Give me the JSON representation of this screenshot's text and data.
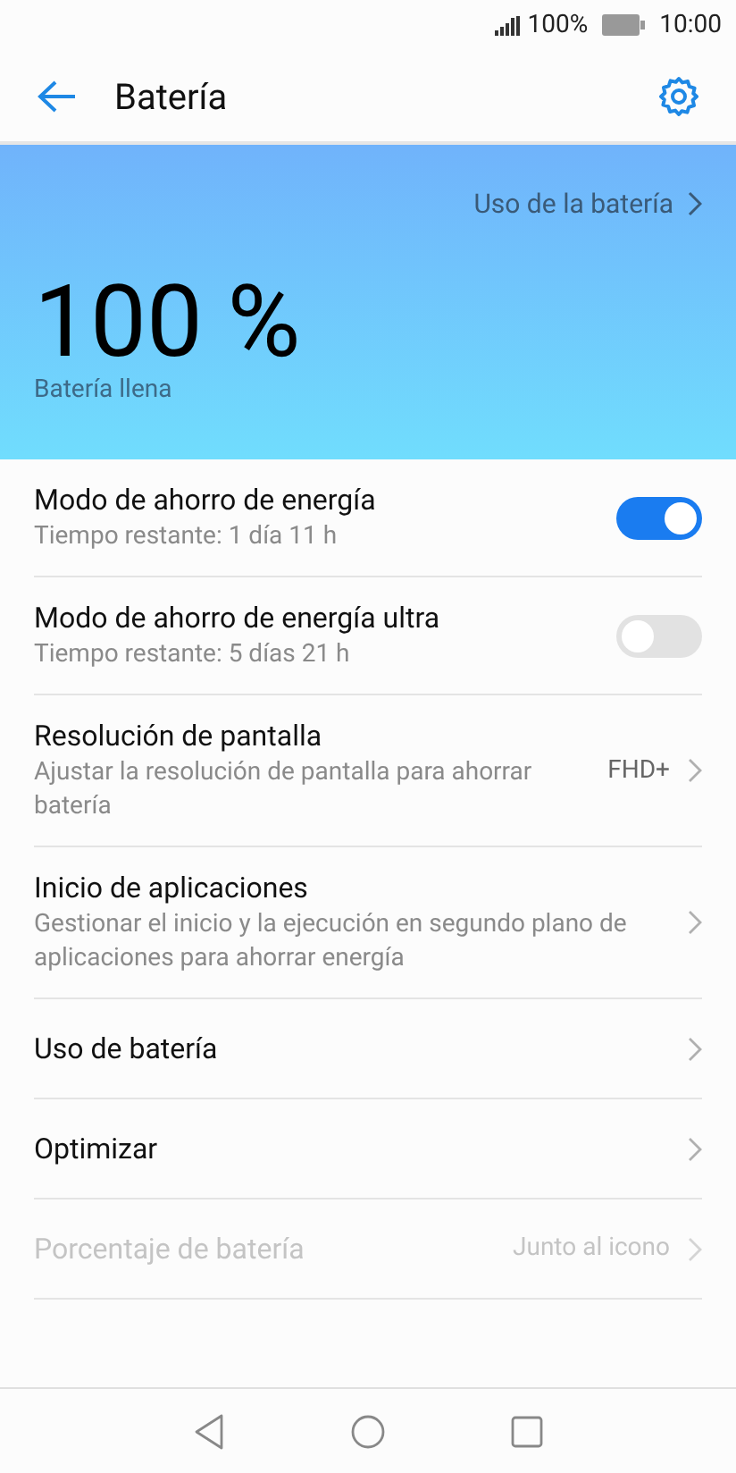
{
  "status_bar": {
    "battery": "100%",
    "time": "10:00"
  },
  "header": {
    "title": "Batería"
  },
  "hero": {
    "link": "Uso de la batería",
    "percent": "100 %",
    "status": "Batería llena"
  },
  "items": [
    {
      "kind": "toggle",
      "title": "Modo de ahorro de energía",
      "subtitle": "Tiempo restante: 1 día 11 h",
      "on": true,
      "disabled": false
    },
    {
      "kind": "toggle",
      "title": "Modo de ahorro de energía ultra",
      "subtitle": "Tiempo restante: 5 días 21 h",
      "on": false,
      "disabled": false
    },
    {
      "kind": "link",
      "title": "Resolución de pantalla",
      "subtitle": "Ajustar la resolución de pantalla para ahorrar batería",
      "value": "FHD+",
      "disabled": false
    },
    {
      "kind": "link",
      "title": "Inicio de aplicaciones",
      "subtitle": "Gestionar el inicio y la ejecución en segundo plano de aplicaciones para ahorrar energía",
      "disabled": false
    },
    {
      "kind": "link",
      "title": "Uso de batería",
      "disabled": false
    },
    {
      "kind": "link",
      "title": "Optimizar",
      "disabled": false
    },
    {
      "kind": "link",
      "title": "Porcentaje de batería",
      "value": "Junto al icono",
      "disabled": true
    }
  ]
}
